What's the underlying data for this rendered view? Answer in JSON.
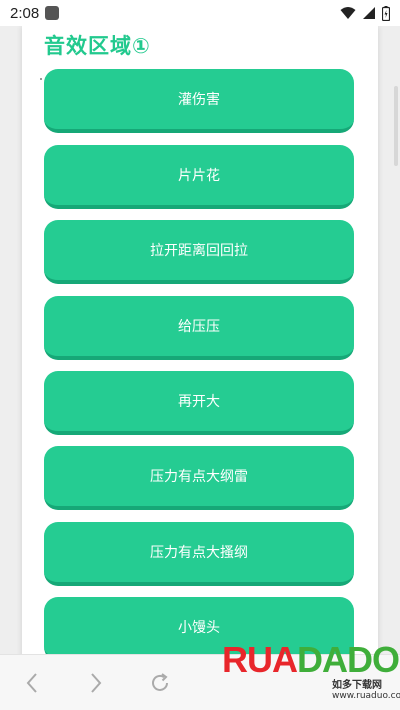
{
  "status_bar": {
    "time": "2:08"
  },
  "section": {
    "title": "音效区域①"
  },
  "buttons": [
    {
      "label": "灌伤害"
    },
    {
      "label": "片片花"
    },
    {
      "label": "拉开距离回回拉"
    },
    {
      "label": "给压压"
    },
    {
      "label": "再开大"
    },
    {
      "label": "压力有点大纲雷"
    },
    {
      "label": "压力有点大搔纲"
    },
    {
      "label": "小馒头"
    }
  ],
  "bottom_nav": {
    "icons": [
      "back-icon",
      "forward-icon",
      "reload-icon"
    ]
  },
  "watermark": {
    "logo_part1": "RUA",
    "logo_part2": "DADO",
    "cn_text": "如多下载网",
    "url_text": "www.ruaduo.com"
  },
  "colors": {
    "accent": "#25cc92",
    "title": "#22c98e"
  }
}
